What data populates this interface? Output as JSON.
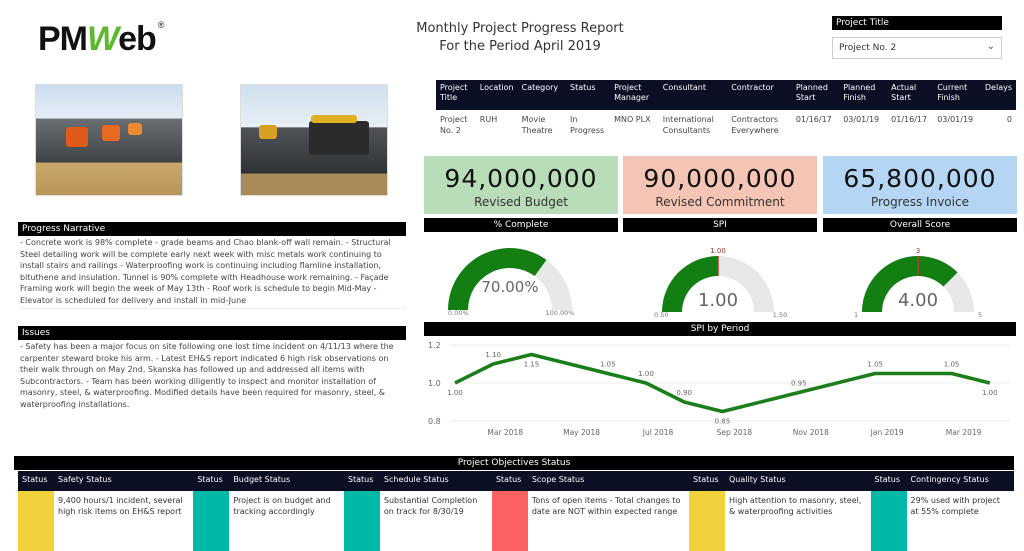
{
  "logo": {
    "text_a": "PM",
    "text_w": "W",
    "text_b": "eb",
    "mark": "®"
  },
  "header": {
    "title_line1": "Monthly Project Progress Report",
    "title_line2": "For the Period April 2019"
  },
  "filter": {
    "label": "Project Title",
    "value": "Project No. 2",
    "icon": "chevron-down-icon"
  },
  "project_table": {
    "columns": [
      "Project Title",
      "Location",
      "Category",
      "Status",
      "Project Manager",
      "Consultant",
      "Contractor",
      "Planned Start",
      "Planned Finish",
      "Actual Start",
      "Current Finish",
      "Delays"
    ],
    "rows": [
      [
        "Project No. 2",
        "RUH",
        "Movie Theatre",
        "In Progress",
        "MNO PLX",
        "International Consultants",
        "Contractors Everywhere",
        "01/16/17",
        "03/01/19",
        "01/16/17",
        "03/01/19",
        "0"
      ]
    ]
  },
  "kpis": [
    {
      "value": "94,000,000",
      "label": "Revised Budget",
      "color": "#b9dcb9"
    },
    {
      "value": "90,000,000",
      "label": "Revised Commitment",
      "color": "#f4c4b4"
    },
    {
      "value": "65,800,000",
      "label": "Progress Invoice",
      "color": "#b4d6f4"
    }
  ],
  "gauges": [
    {
      "title": "% Complete",
      "value": 70,
      "min": 0,
      "max": 100,
      "display": "70.00%",
      "min_label": "0.00%",
      "max_label": "100.00%",
      "target": null,
      "target_label": ""
    },
    {
      "title": "SPI",
      "value": 1.0,
      "min": 0.5,
      "max": 1.5,
      "display": "1.00",
      "min_label": "0.50",
      "max_label": "1.50",
      "target": 1.0,
      "target_label": "1.00"
    },
    {
      "title": "Overall Score",
      "value": 4,
      "min": 1,
      "max": 5,
      "display": "4.00",
      "min_label": "1",
      "max_label": "5",
      "target": 3,
      "target_label": "3"
    }
  ],
  "narrative": {
    "title": "Progress Narrative",
    "text": "- Concrete work is 98% complete - grade beams and Chao blank-off wall remain. - Structural Steel detailing work will be complete early next week with misc metals work continuing to install stairs and railings - Waterproofing work is continuing including flamline installation, bituthene and insulation. Tunnel is 90% complete with Headhouse work remaining. - Façade Framing work will begin the week of May 13th - Roof work is schedule to begin Mid-May - Elevator is scheduled for delivery and install in mid-June"
  },
  "issues": {
    "title": "Issues",
    "text": "- Safety has been a major focus on site following one lost time incident on 4/11/13 where the carpenter steward broke his arm. - Latest EH&S report indicated 6 high risk observations on their walk through on May 2nd. Skanska has followed up and addressed all items with Subcontractors. - Team has been working diligently to inspect and monitor installation of masonry, steel, & waterproofing. Modified details have been required for masonry, steel, & waterproofing installations."
  },
  "chart_data": {
    "type": "line",
    "title": "SPI by Period",
    "xlabel": "",
    "ylabel": "",
    "ylim": [
      0.8,
      1.2
    ],
    "yticks": [
      "1.2",
      "1.0",
      "0.8"
    ],
    "xticks": [
      "Mar 2018",
      "May 2018",
      "Jul 2018",
      "Sep 2018",
      "Nov 2018",
      "Jan 2019",
      "Mar 2019"
    ],
    "series": [
      {
        "name": "SPI",
        "color": "#1a7f1a",
        "x": [
          "Feb 2018",
          "Mar 2018",
          "Apr 2018",
          "Jun 2018",
          "Jul 2018",
          "Aug 2018",
          "Sep 2018",
          "Nov 2018",
          "Jan 2019",
          "Mar 2019",
          "Apr 2019"
        ],
        "month_index": [
          0,
          1,
          2,
          4,
          5,
          6,
          7,
          9,
          11,
          13,
          14
        ],
        "values": [
          1.0,
          1.1,
          1.15,
          1.05,
          1.0,
          0.9,
          0.85,
          0.95,
          1.05,
          1.05,
          1.0
        ],
        "labels": [
          "1.00",
          "1.10",
          "1.15",
          "1.05",
          "1.00",
          "0.90",
          "0.85",
          "0.95",
          "1.05",
          "1.05",
          "1.00"
        ]
      }
    ]
  },
  "objectives": {
    "title": "Project Objectives Status",
    "items": [
      {
        "status_header": "Status",
        "header": "Safety Status",
        "color": "#f2d23c",
        "text": "9,400 hours/1 incident, several high risk items on EH&S report"
      },
      {
        "status_header": "Status",
        "header": "Budget Status",
        "color": "#00b8a8",
        "text": "Project is on budget and tracking accordingly"
      },
      {
        "status_header": "Status",
        "header": "Schedule Status",
        "color": "#00b8a8",
        "text": "Substantial Completion on track for 8/30/19"
      },
      {
        "status_header": "Status",
        "header": "Scope Status",
        "color": "#fb6262",
        "text": "Tons of open items - Total changes to date are NOT within expected range"
      },
      {
        "status_header": "Status",
        "header": "Quality Status",
        "color": "#f2d23c",
        "text": "High attention to masonry, steel, & waterproofing activities"
      },
      {
        "status_header": "Status",
        "header": "Contingency Status",
        "color": "#00b8a8",
        "text": "29% used with project at 55% complete"
      }
    ]
  }
}
